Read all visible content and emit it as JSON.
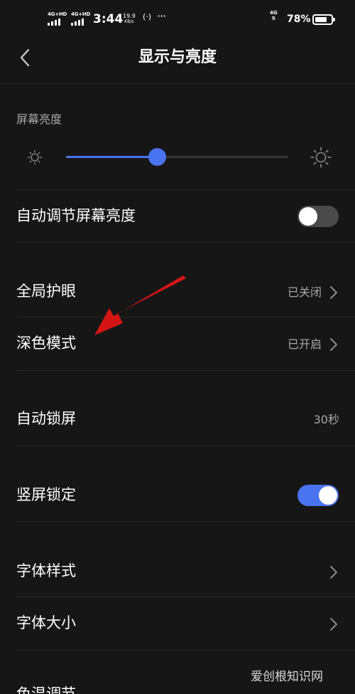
{
  "status_bar": {
    "signal1_network": "4G+HD",
    "signal2_network": "4G+HD",
    "time": "3:44",
    "speed_value": "19.9",
    "speed_unit": "KB/s",
    "more": "···",
    "network_4g": "4G",
    "battery_percent": "78%",
    "battery_level": 0.78
  },
  "header": {
    "title": "显示与亮度",
    "back_icon": "chevron-left-icon"
  },
  "brightness": {
    "label": "屏幕亮度",
    "level": 0.41,
    "low_icon": "sun-small-icon",
    "high_icon": "sun-large-icon",
    "accent_color": "#4a73f0"
  },
  "auto_brightness": {
    "label": "自动调节屏幕亮度",
    "enabled": false
  },
  "eye_protection": {
    "label": "全局护眼",
    "value": "已关闭"
  },
  "dark_mode": {
    "label": "深色模式",
    "value": "已开启"
  },
  "auto_lock": {
    "label": "自动锁屏",
    "value": "30秒"
  },
  "portrait_lock": {
    "label": "竖屏锁定",
    "enabled": true
  },
  "font_style": {
    "label": "字体样式"
  },
  "font_size": {
    "label": "字体大小"
  },
  "next_item_partial": {
    "label": "色温调节"
  },
  "watermark": {
    "text": "爱创根知识网"
  },
  "annotation": {
    "arrow_color": "#d41515"
  }
}
